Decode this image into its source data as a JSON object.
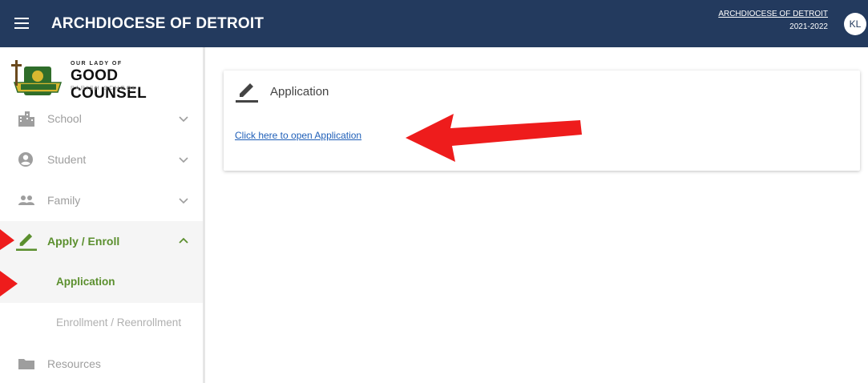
{
  "header": {
    "title": "ARCHDIOCESE OF DETROIT",
    "org_link": "ARCHDIOCESE OF DETROIT",
    "year": "2021-2022",
    "avatar_initials": "KL",
    "bg_color": "#233a5e"
  },
  "sidebar": {
    "logo": {
      "line1": "OUR LADY OF",
      "line2": "GOOD COUNSEL",
      "line3": "PARISH SCHOOL"
    },
    "items": [
      {
        "label": "School",
        "icon": "building-icon",
        "expanded": false
      },
      {
        "label": "Student",
        "icon": "account-circle-icon",
        "expanded": false
      },
      {
        "label": "Family",
        "icon": "people-icon",
        "expanded": false
      },
      {
        "label": "Apply / Enroll",
        "icon": "pencil-icon",
        "expanded": true,
        "children": [
          {
            "label": "Application",
            "active": true
          },
          {
            "label": "Enrollment / Reenrollment",
            "active": false
          }
        ]
      },
      {
        "label": "Resources",
        "icon": "folder-icon",
        "expanded": false
      }
    ],
    "active_color": "#5b8f2e"
  },
  "main": {
    "card": {
      "title": "Application",
      "icon": "pencil-icon",
      "link_text": "Click here to open Application"
    }
  },
  "annotation_color": "#ee1c1c"
}
